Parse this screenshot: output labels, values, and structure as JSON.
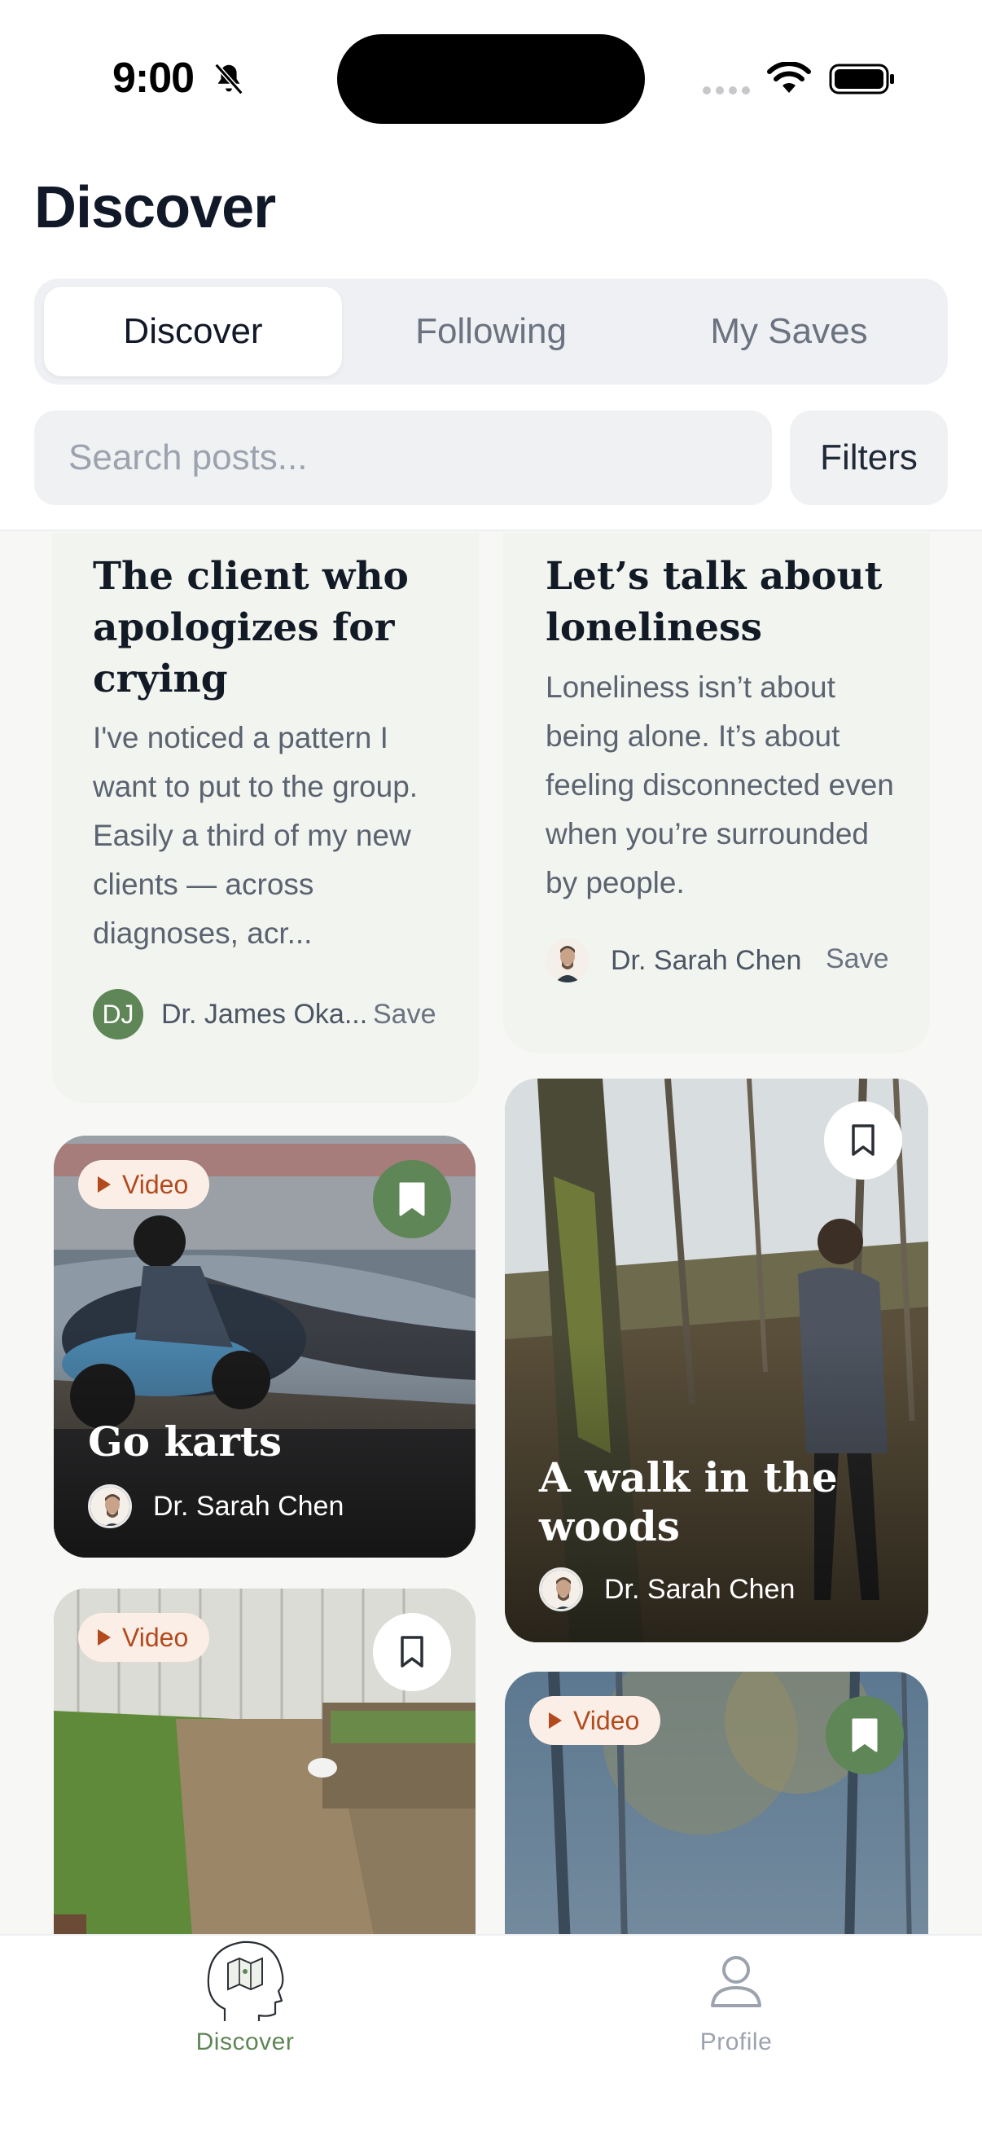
{
  "status_bar": {
    "time": "9:00"
  },
  "header": {
    "title": "Discover"
  },
  "segments": [
    "Discover",
    "Following",
    "My Saves"
  ],
  "search": {
    "placeholder": "Search posts..."
  },
  "filters_label": "Filters",
  "colors": {
    "accent": "#5e8656",
    "video_pill_text": "#b24a1e",
    "card_bg": "#f2f4f0"
  },
  "feed": {
    "text_posts": [
      {
        "title": "The client who apologizes for crying",
        "excerpt": "I've noticed a pattern I want to put to the group. Easily a third of my new clients — across diagnoses, acr...",
        "author": "Dr. James Oka...",
        "author_initials": "DJ",
        "save_label": "Save"
      },
      {
        "title": "Let’s talk about loneliness",
        "excerpt": "Loneliness isn’t about being alone. It’s about feeling disconnected even when you’re surrounded by people.",
        "author": "Dr. Sarah Chen",
        "save_label": "Save"
      }
    ],
    "media_posts": [
      {
        "badge": "Video",
        "title": "Go karts",
        "author": "Dr. Sarah Chen",
        "saved": true
      },
      {
        "title": "A walk in the woods",
        "author": "Dr. Sarah Chen",
        "saved": false
      },
      {
        "badge": "Video",
        "saved": false
      },
      {
        "badge": "Video",
        "saved": true
      }
    ]
  },
  "tabbar": [
    {
      "label": "Discover",
      "icon": "head-map-icon",
      "active": true
    },
    {
      "label": "Profile",
      "icon": "person-icon",
      "active": false
    }
  ]
}
